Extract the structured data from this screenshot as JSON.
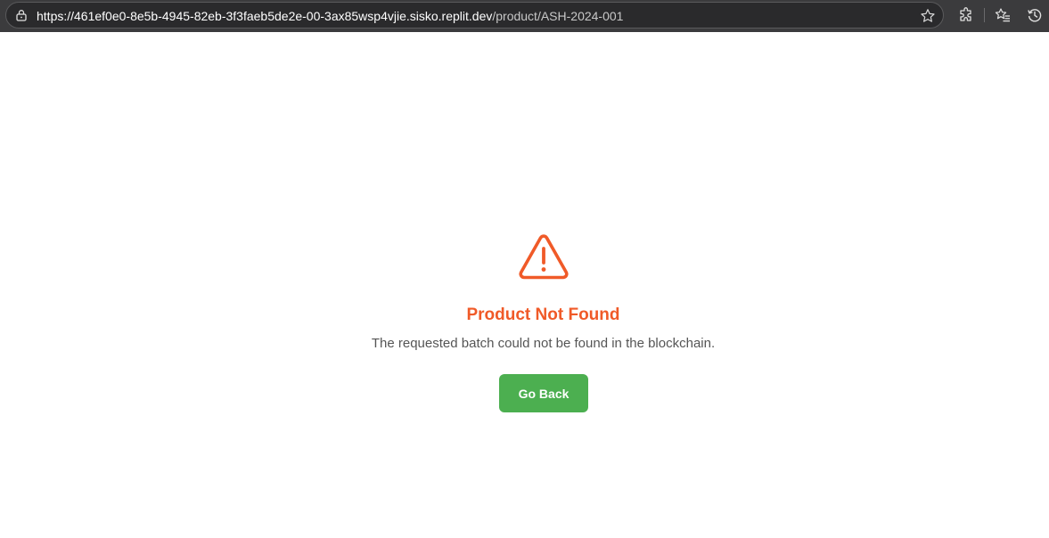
{
  "browser": {
    "url_host": "https://461ef0e0-8e5b-4945-82eb-3f3faeb5de2e-00-3ax85wsp4vjie.sisko.replit.dev",
    "url_path": "/product/ASH-2024-001"
  },
  "error": {
    "icon": "warning-triangle-icon",
    "title": "Product Not Found",
    "message": "The requested batch could not be found in the blockchain.",
    "button_label": "Go Back"
  },
  "colors": {
    "accent_error": "#f05a28",
    "button_green": "#4caf50",
    "browser_chrome": "#3b3b3d"
  }
}
